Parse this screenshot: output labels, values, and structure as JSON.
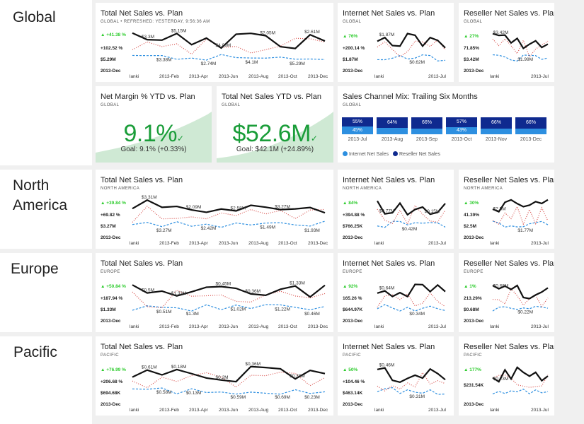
{
  "regions": [
    "Global",
    "North",
    "America",
    "Europe",
    "Pacific"
  ],
  "colors": {
    "actual": "#111111",
    "plan": "#d9534f",
    "internet": "#2d8fe0",
    "reseller": "#0f2a8f",
    "kpi_green": "#2ecc2e",
    "big_green": "#1a9d39"
  },
  "global": {
    "total": {
      "title": "Total Net Sales vs. Plan",
      "subtitle": "GLOBAL  •  REFRESHED: YESTERDAY, 9:56:36 AM",
      "delta": "▲ +41.38 %",
      "pct": "+102.52 %",
      "value": "$5.29M",
      "period": "2013-Dec",
      "labels": [
        "$3.3M",
        "$3.38M",
        "$5.15M",
        "$2.74M",
        "$4.09M",
        "$4.1M",
        "$2.05M",
        "$5.29M",
        "$2.61M"
      ],
      "xaxis": [
        "lanki",
        "2013-Feb",
        "2013-Apr",
        "2013-Jun",
        "2013-Aug",
        "2013-Oct",
        "2013-Dec"
      ]
    },
    "internet": {
      "title": "Internet Net Sales vs. Plan",
      "subtitle": "GLOBAL",
      "delta": "▲ 76%",
      "pct": "+200.14 %",
      "value": "$1.87M",
      "period": "2013-Dec",
      "labels": [
        "$1.87M",
        "$0.62M"
      ],
      "xaxis": [
        "lanki",
        "2013-Jul"
      ]
    },
    "reseller": {
      "title": "Reseller Net Sales vs. Plan",
      "subtitle": "GLOBAL",
      "delta": "▲ 27%",
      "pct": "71.85%",
      "value": "$3.42M",
      "period": "2013-Dec",
      "labels": [
        "$3.42M",
        "$1.99M"
      ],
      "xaxis": [
        "lanki",
        "2013-Jul"
      ]
    },
    "margin": {
      "title": "Net Margin % YTD vs. Plan",
      "subtitle": "GLOBAL",
      "value": "9.1%",
      "goal": "Goal: 9.1% (+0.33%)",
      "check": "✓"
    },
    "ytd": {
      "title": "Total Net Sales YTD vs. Plan",
      "subtitle": "GLOBAL",
      "value": "$52.6M",
      "goal": "Goal: $42.1M (+24.89%)",
      "check": "✓"
    },
    "mix": {
      "title": "Sales Channel Mix: Trailing Six Months",
      "subtitle": "GLOBAL",
      "months": [
        "2013-Jul",
        "2013-Aug",
        "2013-Sep",
        "2013-Oct",
        "2013-Nov",
        "2013-Dec"
      ],
      "reseller_pct": [
        55,
        64,
        66,
        57,
        66,
        66
      ],
      "internet_pct": [
        45,
        36,
        34,
        43,
        34,
        34
      ],
      "top_labels": [
        "55%",
        "64%",
        "66%",
        "57%",
        "66%",
        "66%"
      ],
      "bottom_labels": [
        "45%",
        "",
        "",
        "43%",
        "",
        ""
      ],
      "legend": [
        "Internet Net Sales",
        "Reseller Net Sales"
      ]
    }
  },
  "north": {
    "total": {
      "title": "Total Net Sales vs. Plan",
      "subtitle": "NORTH AMERICA",
      "delta": "▲ +39.84 %",
      "pct": "+69.82 %",
      "value": "$3.27M",
      "period": "2013-Dec",
      "labels": [
        "$3.31M",
        "$3.27M",
        "$2.09M",
        "$2.42M",
        "$2.58M",
        "$1.49M",
        "$3.27M",
        "$1.93M"
      ],
      "xaxis": [
        "lanki",
        "2013-Feb",
        "2013-Apr",
        "2013-Jun",
        "2013-Aug",
        "2013-Oct",
        "2013-Dec"
      ]
    },
    "internet": {
      "title": "Internet Net Sales vs. Plan",
      "subtitle": "NORTH AMERICA",
      "delta": "▲ 84%",
      "pct": "+394.88 %",
      "value": "$766.25K",
      "period": "2013-Dec",
      "labels": [
        "$0.77M",
        "$0.42M",
        "$0.15M"
      ],
      "xaxis": [
        "lanki",
        "2013-Jul"
      ]
    },
    "reseller": {
      "title": "Reseller Net Sales vs. Plan",
      "subtitle": "NORTH AMERICA",
      "delta": "▲ 30%",
      "pct": "41.39%",
      "value": "$2.5M",
      "period": "2013-Dec",
      "labels": [
        "$2.5M",
        "$1.77M"
      ],
      "xaxis": [
        "lanki",
        "2013-Jul"
      ]
    }
  },
  "europe": {
    "total": {
      "title": "Total Net Sales vs. Plan",
      "subtitle": "EUROPE",
      "delta": "▲ +50.84 %",
      "pct": "+187.94 %",
      "value": "$1.33M",
      "period": "2013-Dec",
      "labels": [
        "$0.5M",
        "$0.51M",
        "$1.32M",
        "$1.3M",
        "$0.45M",
        "$1.02M",
        "$0.36M",
        "$1.22M",
        "$1.33M",
        "$0.46M"
      ],
      "xaxis": [
        "lanki",
        "2013-Feb",
        "2013-Apr",
        "2013-Jun",
        "2013-Aug",
        "2013-Oct",
        "2013-Dec"
      ]
    },
    "internet": {
      "title": "Internet Net Sales vs. Plan",
      "subtitle": "EUROPE",
      "delta": "▲ 92%",
      "pct": "165.26 %",
      "value": "$644.97K",
      "period": "2013-Dec",
      "labels": [
        "$0.64M",
        "$0.34M"
      ],
      "xaxis": [
        "lanki",
        "2013-Jul"
      ]
    },
    "reseller": {
      "title": "Reseller Net Sales vs. Plan",
      "subtitle": "EUROPE",
      "delta": "▲ 1%",
      "pct": "213.29%",
      "value": "$0.68M",
      "period": "2013-Dec",
      "labels": [
        "$0.68M",
        "$0.22M"
      ],
      "xaxis": [
        "lanki",
        "2013-Jul"
      ]
    }
  },
  "pacific": {
    "total": {
      "title": "Total Net Sales vs. Plan",
      "subtitle": "PACIFIC",
      "delta": "▲ +76.99 %",
      "pct": "+206.68 %",
      "value": "$694.68K",
      "period": "2013-Dec",
      "labels": [
        "$0.61M",
        "$0.58M",
        "$0.18M",
        "$0.13M",
        "$0.2M",
        "$0.59M",
        "$0.36M",
        "$0.69M",
        "$0.39M",
        "$0.23M"
      ],
      "xaxis": [
        "lanki",
        "2013-Feb",
        "2013-Apr",
        "2013-Jun",
        "2013-Aug",
        "2013-Oct",
        "2013-Dec"
      ]
    },
    "internet": {
      "title": "Internet Net Sales vs. Plan",
      "subtitle": "PACIFIC",
      "delta": "▲ 50%",
      "pct": "+104.46 %",
      "value": "$463.14K",
      "period": "2013-Dec",
      "labels": [
        "$0.46M",
        "$0.31M"
      ],
      "xaxis": [
        "lanki",
        "2013-Jul"
      ]
    },
    "reseller": {
      "title": "Reseller Net Sales vs. Plan",
      "subtitle": "PACIFIC",
      "delta": "▲ 177%",
      "pct": "$231.54K",
      "value": "",
      "period": "2013-Dec",
      "labels": [
        "$0.23M"
      ],
      "xaxis": [
        "lanki",
        "2013-Jul"
      ]
    }
  }
}
